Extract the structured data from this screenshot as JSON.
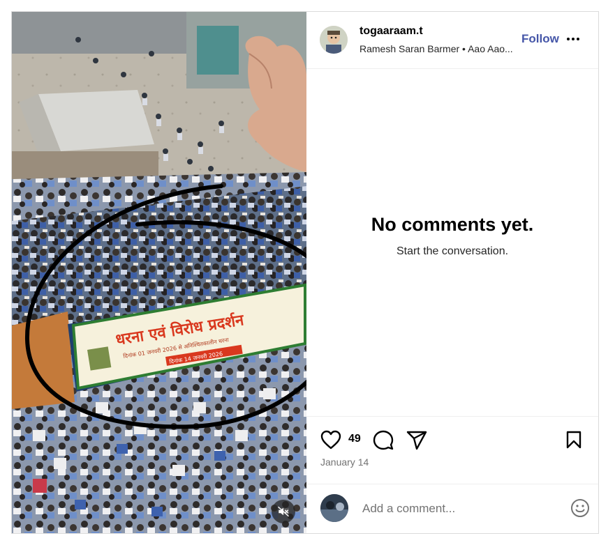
{
  "post": {
    "username": "togaaraam.t",
    "subtitle": "Ramesh Saran Barmer • Aao Aao...",
    "follow_label": "Follow",
    "empty_title": "No comments yet.",
    "empty_subtitle": "Start the conversation.",
    "likes": "49",
    "date": "January 14",
    "comment_placeholder": "Add a comment..."
  },
  "banner": {
    "headline": "धरना एवं विरोध प्रदर्शन",
    "line1": "दिनांक 01 जनवरी 2026 से अनिश्चितकालीन धरना",
    "date_label": "दिनांक 14 जनवरी 2026"
  },
  "icons": {
    "more": "more-options-icon",
    "like": "heart-icon",
    "comment": "comment-icon",
    "share": "share-icon",
    "save": "bookmark-icon",
    "emoji": "emoji-icon",
    "mute": "muted-speaker-icon"
  },
  "colors": {
    "follow": "#4556a8",
    "banner_text": "#d9381e",
    "banner_bg": "#f6f1dc"
  }
}
